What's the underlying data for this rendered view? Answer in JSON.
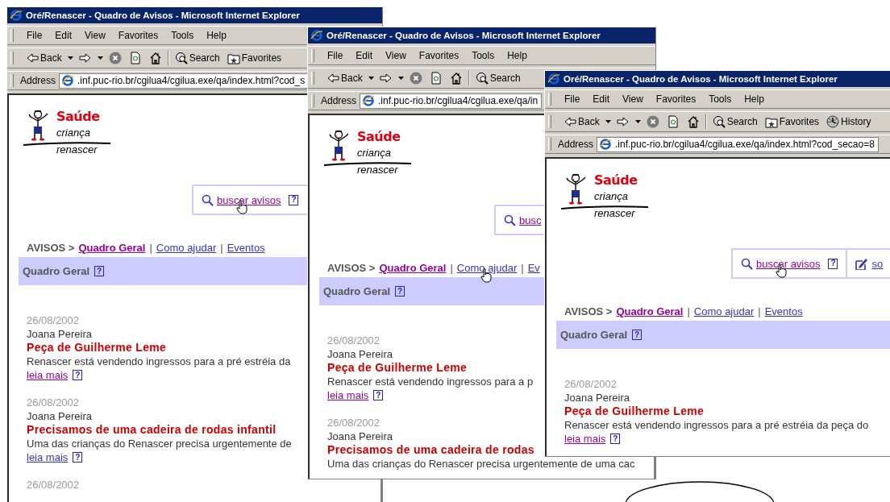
{
  "windows": [
    {
      "title": "Oré/Renascer - Quadro de Avisos - Microsoft Internet Explorer",
      "menu": [
        "File",
        "Edit",
        "View",
        "Favorites",
        "Tools",
        "Help"
      ],
      "toolbar": [
        {
          "kind": "back",
          "label": "Back"
        },
        {
          "kind": "forward"
        },
        {
          "kind": "stop"
        },
        {
          "kind": "refresh"
        },
        {
          "kind": "home"
        },
        {
          "kind": "search",
          "label": "Search"
        },
        {
          "kind": "favorites",
          "label": "Favorites"
        }
      ],
      "address_label": "Address",
      "address": ".inf.puc-rio.br/cgilua4/cgilua.exe/qa/index.html?cod_s",
      "logo": [
        "Saúde",
        "criança",
        "renascer"
      ],
      "actions": [
        {
          "kind": "search",
          "label": "buscar avisos",
          "help": "?",
          "visited": true,
          "hovered": true
        }
      ],
      "breadcrumb": {
        "root": "AVISOS >",
        "links": [
          {
            "label": "Quadro Geral",
            "selected": true,
            "visited": true,
            "hovered": false,
            "separator": "|"
          },
          {
            "label": "Como ajudar",
            "selected": false,
            "visited": false,
            "hovered": false,
            "separator": "|"
          },
          {
            "label": "Eventos",
            "selected": false,
            "visited": false,
            "hovered": false
          }
        ]
      },
      "section": {
        "title": "Quadro Geral",
        "help": "?"
      },
      "posts": [
        {
          "date": "26/08/2002",
          "author": "Joana Pereira",
          "title": "Peça de Guilherme Leme",
          "summary": "Renascer está vendendo ingressos para a pré estréia da",
          "more": "leia mais",
          "help": "?",
          "visited": true
        },
        {
          "date": "26/08/2002",
          "author": "Joana Pereira",
          "title": "Precisamos de uma cadeira de rodas infantil",
          "summary": "Uma das crianças do Renascer precisa urgentemente de",
          "more": "leia mais",
          "help": "?",
          "visited": false
        },
        {
          "date": "26/08/2002"
        }
      ]
    },
    {
      "title": "Oré/Renascer - Quadro de Avisos - Microsoft Internet Explorer",
      "menu": [
        "File",
        "Edit",
        "View",
        "Favorites",
        "Tools",
        "Help"
      ],
      "toolbar": [
        {
          "kind": "back",
          "label": "Back"
        },
        {
          "kind": "forward"
        },
        {
          "kind": "stop"
        },
        {
          "kind": "refresh"
        },
        {
          "kind": "home"
        },
        {
          "kind": "search",
          "label": "Search"
        }
      ],
      "address_label": "Address",
      "address": ".inf.puc-rio.br/cgilua4/cgilua.exe/qa/in",
      "logo": [
        "Saúde",
        "criança",
        "renascer"
      ],
      "actions": [
        {
          "kind": "search",
          "label": "busc",
          "visited": true,
          "hovered": false
        }
      ],
      "breadcrumb": {
        "root": "AVISOS >",
        "links": [
          {
            "label": "Quadro Geral",
            "selected": true,
            "visited": true,
            "hovered": false,
            "separator": "|"
          },
          {
            "label": "Como ajudar",
            "selected": false,
            "visited": false,
            "hovered": true,
            "separator": "|"
          },
          {
            "label": "Ev",
            "selected": false,
            "visited": false,
            "hovered": false
          }
        ]
      },
      "section": {
        "title": "Quadro Geral",
        "help": "?"
      },
      "posts": [
        {
          "date": "26/08/2002",
          "author": "Joana Pereira",
          "title": "Peça de Guilherme Leme",
          "summary": "Renascer está vendendo ingressos para a p",
          "more": "leia mais",
          "help": "?",
          "visited": true
        },
        {
          "date": "26/08/2002",
          "author": "Joana Pereira",
          "title": "Precisamos de uma cadeira de rodas",
          "summary": "Uma das crianças do Renascer precisa urgentemente de uma cac"
        }
      ]
    },
    {
      "title": "Oré/Renascer - Quadro de Avisos - Microsoft Internet Explorer",
      "menu": [
        "File",
        "Edit",
        "View",
        "Favorites",
        "Tools",
        "Help"
      ],
      "toolbar": [
        {
          "kind": "back",
          "label": "Back"
        },
        {
          "kind": "forward"
        },
        {
          "kind": "stop"
        },
        {
          "kind": "refresh"
        },
        {
          "kind": "home"
        },
        {
          "kind": "search",
          "label": "Search"
        },
        {
          "kind": "favorites",
          "label": "Favorites"
        },
        {
          "kind": "history",
          "label": "History"
        }
      ],
      "address_label": "Address",
      "address": ".inf.puc-rio.br/cgilua4/cgilua.exe/qa/index.html?cod_secao=8",
      "logo": [
        "Saúde",
        "criança",
        "renascer"
      ],
      "actions": [
        {
          "kind": "search",
          "label": "buscar avisos",
          "help": "?",
          "visited": true,
          "hovered": true
        },
        {
          "kind": "write",
          "label": "so",
          "visited": false,
          "hovered": false
        }
      ],
      "breadcrumb": {
        "root": "AVISOS >",
        "links": [
          {
            "label": "Quadro Geral",
            "selected": true,
            "visited": true,
            "hovered": false,
            "separator": "|"
          },
          {
            "label": "Como ajudar",
            "selected": false,
            "visited": false,
            "hovered": false,
            "separator": "|"
          },
          {
            "label": "Eventos",
            "selected": false,
            "visited": false,
            "hovered": false
          }
        ]
      },
      "section": {
        "title": "Quadro Geral",
        "help": "?"
      },
      "posts": [
        {
          "date": "26/08/2002",
          "author": "Joana Pereira",
          "title": "Peça de Guilherme Leme",
          "summary": "Renascer está vendendo ingressos para a pré estréia da peça do",
          "more": "leia mais",
          "help": "?",
          "visited": true
        }
      ]
    }
  ]
}
